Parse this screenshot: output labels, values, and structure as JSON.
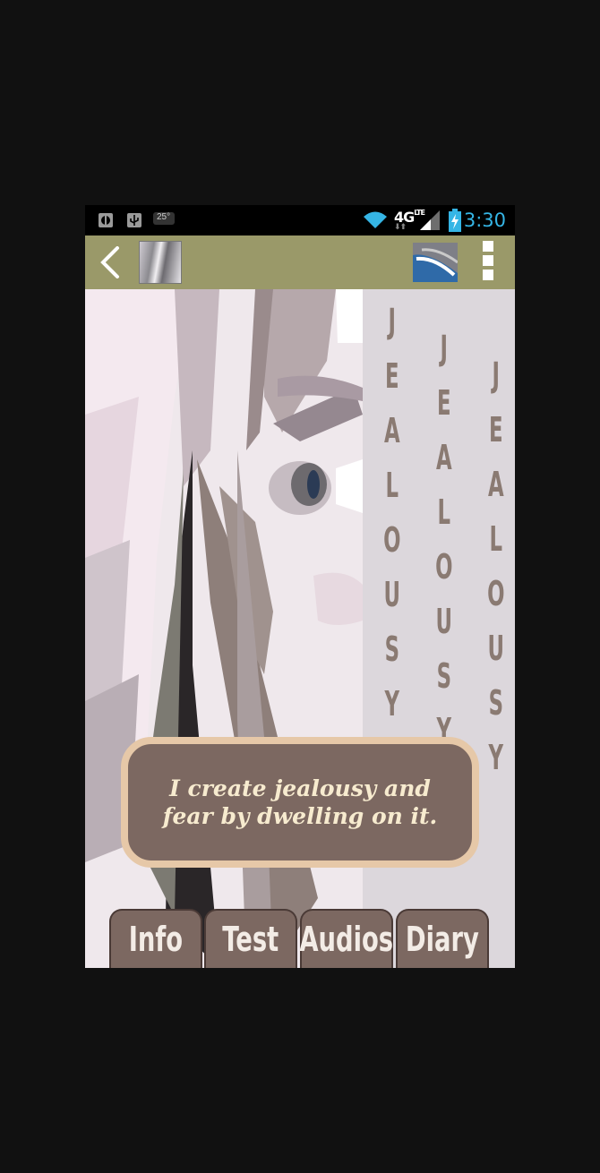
{
  "status_bar": {
    "time": "3:30",
    "network": "4G",
    "temp": "25°",
    "icons": [
      "android-debug-icon",
      "usb-icon",
      "weather-icon",
      "wifi-icon",
      "4g-lte-icon",
      "signal-icon",
      "battery-charging-icon"
    ]
  },
  "action_bar": {
    "back_icon": "chevron-left-icon",
    "app_icon": "app-thumbnail",
    "share_icon": "share-icon",
    "overflow_icon": "overflow-menu-icon",
    "color": "#9a9969"
  },
  "main": {
    "vertical_word_1": "JEALOUSY",
    "vertical_word_2": "JEALOUSY",
    "vertical_word_3": "JEALOUSY",
    "quote": "I create jealousy and fear by dwelling on it."
  },
  "tabs": [
    {
      "label": "Info"
    },
    {
      "label": "Test"
    },
    {
      "label": "Audios"
    },
    {
      "label": "Diary"
    }
  ],
  "colors": {
    "background": "#111111",
    "tab_fill": "#7c6861",
    "quote_border": "#e6c8a8",
    "quote_text": "#f7ebcf",
    "word_color": "#8a7a72",
    "time_color": "#35b5e5"
  }
}
